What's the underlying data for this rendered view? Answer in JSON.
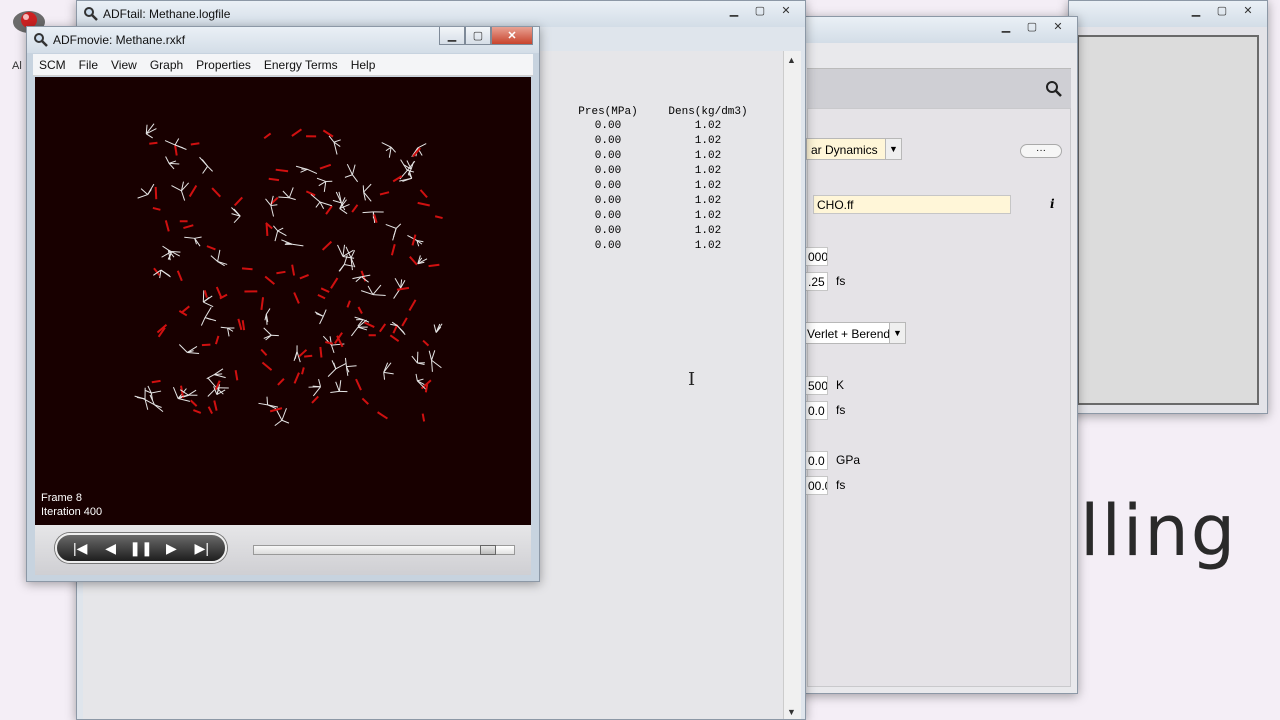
{
  "desktop": {
    "icon_label": "Al"
  },
  "windows": {
    "bg_right": {
      "title": ""
    },
    "input_panel": {
      "task_value": "ar Dynamics",
      "more_label": "···",
      "info_label": "i",
      "forcefield_value": "CHO.ff",
      "iterations_value": "000",
      "timestep_value": ".25",
      "timestep_unit": "fs",
      "thermostat_value": "Verlet + Berend",
      "temperature_value": "500",
      "temperature_unit": "K",
      "damping_value": "0.0",
      "damping_unit": "fs",
      "pressure_value": "0.0",
      "pressure_unit": "GPa",
      "pdamping_value": "00.0",
      "pdamping_unit": "fs",
      "banner_text": "lling"
    },
    "adftail": {
      "title": "ADFtail: Methane.logfile",
      "columns": [
        "Pres(MPa)",
        "Dens(kg/dm3)"
      ],
      "rows": [
        [
          "0.00",
          "1.02"
        ],
        [
          "0.00",
          "1.02"
        ],
        [
          "0.00",
          "1.02"
        ],
        [
          "0.00",
          "1.02"
        ],
        [
          "0.00",
          "1.02"
        ],
        [
          "0.00",
          "1.02"
        ],
        [
          "0.00",
          "1.02"
        ],
        [
          "0.00",
          "1.02"
        ],
        [
          "0.00",
          "1.02"
        ]
      ]
    },
    "adfmovie": {
      "title": "ADFmovie: Methane.rxkf",
      "menu": [
        "SCM",
        "File",
        "View",
        "Graph",
        "Properties",
        "Energy Terms",
        "Help"
      ],
      "frame_label": "Frame 8",
      "iteration_label": "Iteration 400",
      "progress_fraction": 0.93
    }
  },
  "colors": {
    "viewport_bg": "#180000",
    "molecule_white": "#e6e6e6",
    "molecule_red": "#d01010",
    "field_highlight": "#fff6d8"
  }
}
